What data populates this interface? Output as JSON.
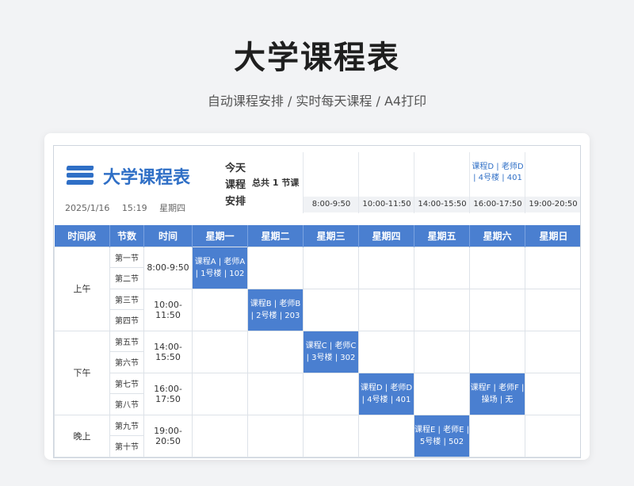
{
  "page": {
    "title": "大学课程表",
    "subtitle": "自动课程安排 / 实时每天课程 / A4打印"
  },
  "sheet": {
    "logo_title": "大学课程表",
    "date": "2025/1/16",
    "time": "15:19",
    "weekday": "星期四",
    "today_label": [
      "今天",
      "课程",
      "安排"
    ],
    "total_text": "总共 1 节课",
    "today_slots": [
      {
        "course": "",
        "time": "8:00-9:50"
      },
      {
        "course": "",
        "time": "10:00-11:50"
      },
      {
        "course": "",
        "time": "14:00-15:50"
      },
      {
        "course": "课程D | 老师D | 4号楼 | 401",
        "time": "16:00-17:50"
      },
      {
        "course": "",
        "time": "19:00-20:50"
      }
    ]
  },
  "table": {
    "headers": [
      "时间段",
      "节数",
      "时间",
      "星期一",
      "星期二",
      "星期三",
      "星期四",
      "星期五",
      "星期六",
      "星期日"
    ],
    "segments": [
      "上午",
      "下午",
      "晚上"
    ],
    "periods": [
      "第一节",
      "第二节",
      "第三节",
      "第四节",
      "第五节",
      "第六节",
      "第七节",
      "第八节",
      "第九节",
      "第十节"
    ],
    "times": [
      "8:00-9:50",
      "10:00-11:50",
      "14:00-15:50",
      "16:00-17:50",
      "19:00-20:50"
    ],
    "courses": {
      "c0": "课程A | 老师A | 1号楼 | 102",
      "c1": "课程B | 老师B | 2号楼 | 203",
      "c2": "课程C | 老师C | 3号楼 | 302",
      "c3": "课程D | 老师D | 4号楼 | 401",
      "c4": "课程F | 老师F | 操场 | 无",
      "c5": "课程E | 老师E | 5号楼 | 502"
    }
  },
  "colors": {
    "accent": "#4a7fd0",
    "brand": "#2f6fc6"
  }
}
